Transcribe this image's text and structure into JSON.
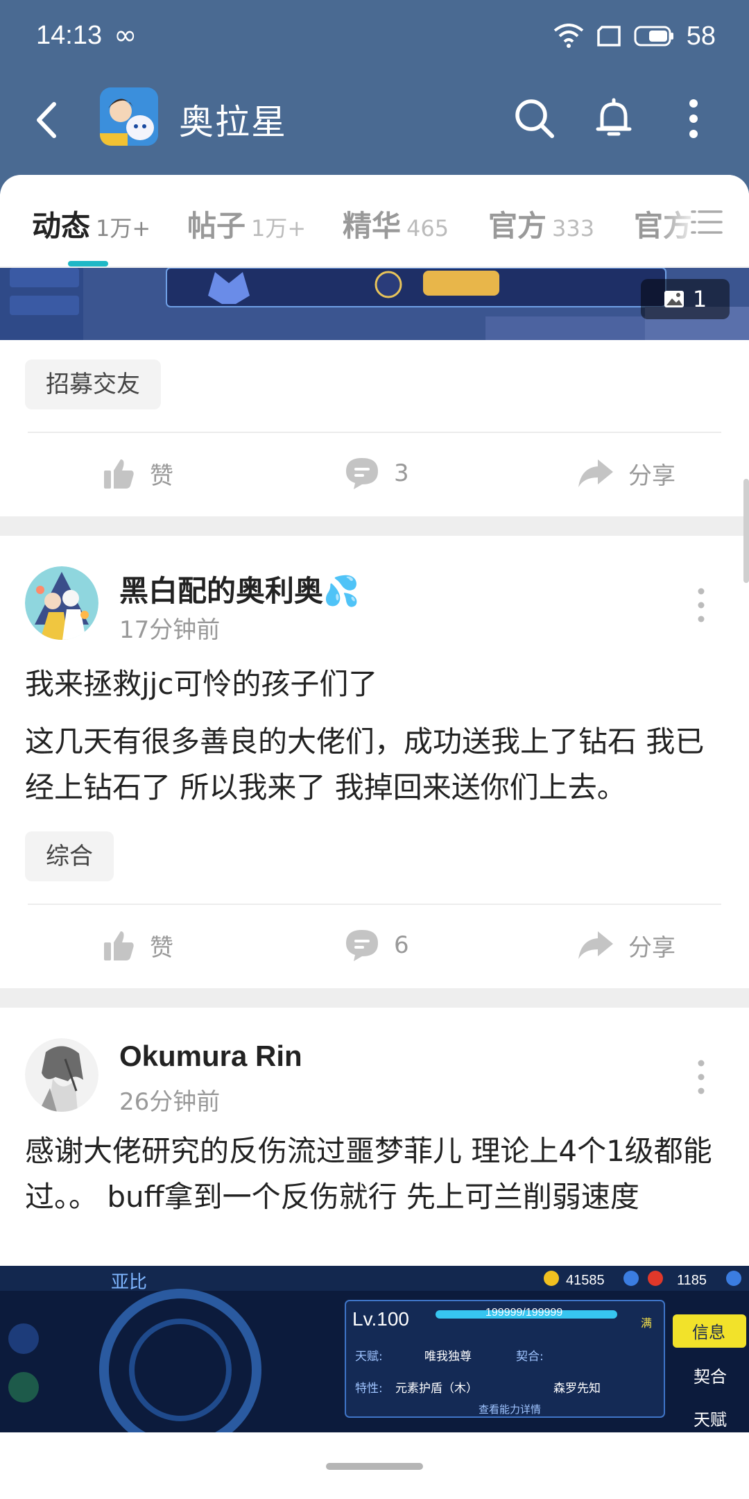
{
  "status_bar": {
    "time": "14:13",
    "battery": "58"
  },
  "app_bar": {
    "title": "奥拉星"
  },
  "tabs": [
    {
      "label": "动态",
      "count": "1万+"
    },
    {
      "label": "帖子",
      "count": "1万+"
    },
    {
      "label": "精华",
      "count": "465"
    },
    {
      "label": "官方",
      "count": "333"
    },
    {
      "label": "官方",
      "count": ""
    }
  ],
  "banner": {
    "image_count": "1"
  },
  "posts": [
    {
      "tag": "招募交友",
      "like_label": "赞",
      "comment_count": "3",
      "share_label": "分享"
    },
    {
      "author": "黑白配的奥利奥💦",
      "time": "17分钟前",
      "title": "我来拯救jjc可怜的孩子们了",
      "body": "这几天有很多善良的大佬们，成功送我上了钻石 我已经上钻石了 所以我来了 我掉回来送你们上去。",
      "tag": "综合",
      "like_label": "赞",
      "comment_count": "6",
      "share_label": "分享"
    },
    {
      "author": "Okumura Rin",
      "time": "26分钟前",
      "body": "感谢大佬研究的反伤流过噩梦菲儿 理论上4个1级都能过。。 buff拿到一个反伤就行 先上可兰削弱速度"
    }
  ],
  "game_screenshot": {
    "location": "亚比",
    "currency_a": "41585",
    "currency_b": "1185",
    "level": "Lv.100",
    "exp": "199999/199999",
    "full_label": "满",
    "talent_label": "天赋:",
    "talent_value": "唯我独尊",
    "contract_label": "契合:",
    "trait_label": "特性:",
    "trait_value": "元素护盾（木）",
    "trait_value_2": "森罗先知",
    "details_link": "查看能力详情",
    "side_tabs": [
      "信息",
      "契合",
      "天赋"
    ]
  }
}
